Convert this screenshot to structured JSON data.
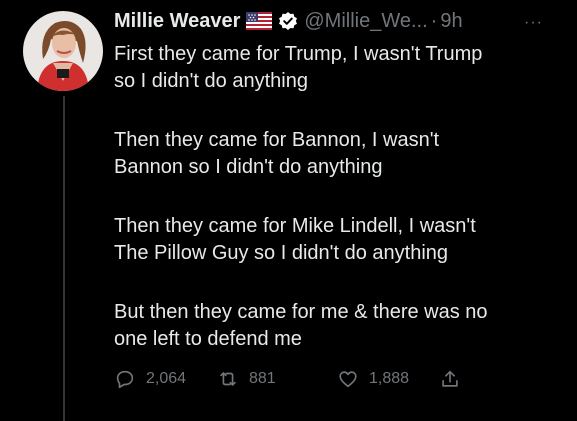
{
  "tweet": {
    "display_name": "Millie Weaver",
    "handle": "@Millie_We...",
    "separator": "·",
    "time": "9h",
    "more": "···",
    "paragraphs": [
      [
        "First they came for Trump, I wasn't Trump",
        "so I didn't do anything"
      ],
      [
        "Then they came for Bannon, I wasn't",
        "Bannon so I didn't do anything"
      ],
      [
        "Then they came for Mike Lindell, I wasn't",
        "The Pillow Guy so I didn't do anything"
      ],
      [
        "But then they came for me & there was no",
        "one left to defend me"
      ]
    ],
    "replies": "2,064",
    "retweets": "881",
    "likes": "1,888"
  },
  "icons": {
    "flag": "us-flag-icon",
    "verified": "verified-badge-icon",
    "reply": "reply-icon",
    "retweet": "retweet-icon",
    "like": "heart-icon",
    "share": "share-icon"
  },
  "colors": {
    "background": "#000000",
    "text": "#e7e9ea",
    "muted": "#71767b",
    "thread_line": "#333639"
  }
}
